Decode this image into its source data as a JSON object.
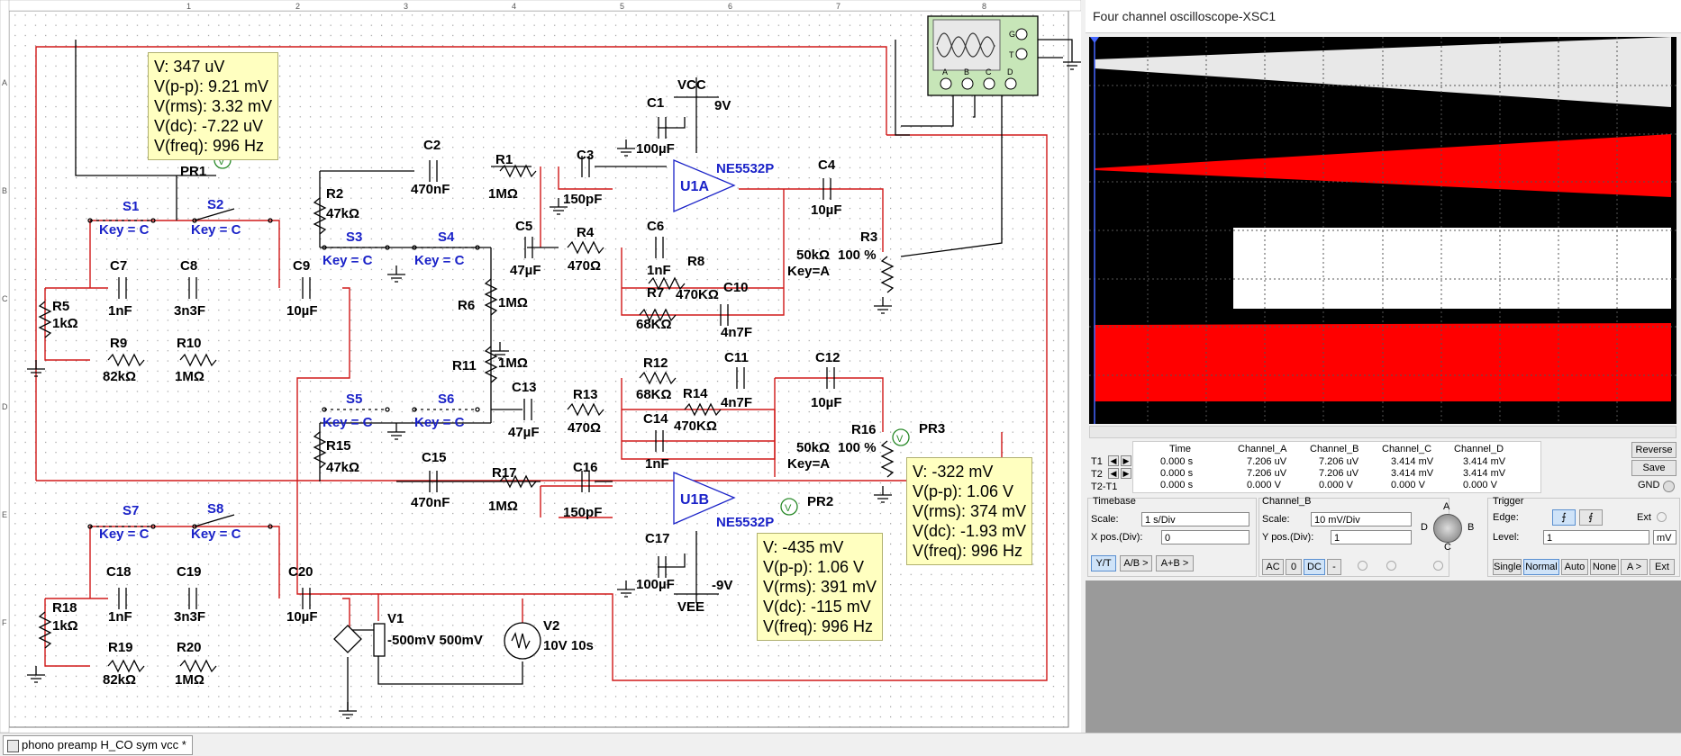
{
  "taskbar": {
    "tab_label": "phono preamp H_CO sym vcc *"
  },
  "ruler": {
    "cols": [
      "1",
      "2",
      "3",
      "4",
      "5",
      "6",
      "7",
      "8"
    ],
    "rows": [
      "A",
      "B",
      "C",
      "D",
      "E",
      "F"
    ]
  },
  "schematic": {
    "labels": {
      "pr1": "PR1",
      "pr2": "PR2",
      "pr3": "PR3",
      "vcc": "VCC",
      "vcc_val": "9V",
      "vee": "VEE",
      "vee_val": "-9V",
      "c1": "C1",
      "c1_val": "100µF",
      "c2": "C2",
      "c2_val": "470nF",
      "r1": "R1",
      "r1_val": "1MΩ",
      "c3": "C3",
      "c3_val": "150pF",
      "u1a": "U1A",
      "u1a_part": "NE5532P",
      "c4": "C4",
      "c4_val": "10µF",
      "r2": "R2",
      "r2_val": "47kΩ",
      "s1": "S1",
      "s1_key": "Key = C",
      "s2": "S2",
      "s2_key": "Key = C",
      "s3": "S3",
      "s3_key": "Key = C",
      "s4": "S4",
      "s4_key": "Key = C",
      "c5": "C5",
      "c5_val": "47µF",
      "r4": "R4",
      "r4_val": "470Ω",
      "c6": "C6",
      "c6_val": "1nF",
      "r8": "R8",
      "r8_val": "470KΩ",
      "r7": "R7",
      "r7_val": "68KΩ",
      "c10": "C10",
      "c10_val": "4n7F",
      "r3": "R3",
      "r3_val": "50kΩ",
      "r3_pct": "100 %",
      "r3_key": "Key=A",
      "c7": "C7",
      "c7_val": "1nF",
      "c8": "C8",
      "c8_val": "3n3F",
      "c9": "C9",
      "c9_val": "10µF",
      "r5": "R5",
      "r5_val": "1kΩ",
      "r9": "R9",
      "r9_val": "82kΩ",
      "r10": "R10",
      "r10_val": "1MΩ",
      "r6": "R6",
      "r6_val": "1MΩ",
      "r11": "R11",
      "r11_val": "1MΩ",
      "c13": "C13",
      "c13_val": "47µF",
      "r13": "R13",
      "r13_val": "470Ω",
      "r12": "R12",
      "r12_val": "68KΩ",
      "c11": "C11",
      "r14": "R14",
      "r14_val": "4n7F",
      "c12": "C12",
      "c12_val": "10µF",
      "c14": "C14",
      "c14_res": "470KΩ",
      "c14_val": "1nF",
      "s5": "S5",
      "s5_key": "Key = C",
      "s6": "S6",
      "s6_key": "Key = C",
      "r15": "R15",
      "r15_val": "47kΩ",
      "c15": "C15",
      "c15_val": "470nF",
      "r17": "R17",
      "r17_val": "1MΩ",
      "c16": "C16",
      "c16_val": "150pF",
      "u1b": "U1B",
      "u1b_part": "NE5532P",
      "c17": "C17",
      "c17_val": "100µF",
      "r16": "R16",
      "r16_val": "50kΩ",
      "r16_pct": "100 %",
      "r16_key": "Key=A",
      "s7": "S7",
      "s7_key": "Key = C",
      "s8": "S8",
      "s8_key": "Key = C",
      "c18": "C18",
      "c18_val": "1nF",
      "c19": "C19",
      "c19_val": "3n3F",
      "c20": "C20",
      "c20_val": "10µF",
      "r18": "R18",
      "r18_val": "1kΩ",
      "r19": "R19",
      "r19_val": "82kΩ",
      "r20": "R20",
      "r20_val": "1MΩ",
      "v1": "V1",
      "v1_val": "-500mV 500mV",
      "v2": "V2",
      "v2_val": "10V 10s",
      "scope_a": "A",
      "scope_b": "B",
      "scope_c": "C",
      "scope_d": "D",
      "scope_g": "G",
      "scope_t": "T"
    },
    "probe1": [
      "V: 347 uV",
      "V(p-p): 9.21 mV",
      "V(rms): 3.32 mV",
      "V(dc): -7.22 uV",
      "V(freq): 996 Hz"
    ],
    "probe2": [
      "V: -435 mV",
      "V(p-p): 1.06 V",
      "V(rms): 391 mV",
      "V(dc): -115 mV",
      "V(freq): 996 Hz"
    ],
    "probe3": [
      "V: -322 mV",
      "V(p-p): 1.06 V",
      "V(rms): 374 mV",
      "V(dc): -1.93 mV",
      "V(freq): 996 Hz"
    ],
    "colors": {
      "wire_red": "#d01818",
      "wire_black": "#000000",
      "probe_bg": "#ffffc0"
    }
  },
  "scope": {
    "title": "Four channel oscilloscope-XSC1",
    "channel_colors": {
      "a": "#e8e8e8",
      "b": "#ff0000",
      "c": "#ffffff",
      "d": "#ff0000"
    },
    "table": {
      "headers": [
        "Time",
        "Channel_A",
        "Channel_B",
        "Channel_C",
        "Channel_D"
      ],
      "rows": [
        {
          "label": "T1",
          "vals": [
            "0.000 s",
            "7.206 uV",
            "7.206 uV",
            "3.414 mV",
            "3.414 mV"
          ]
        },
        {
          "label": "T2",
          "vals": [
            "0.000 s",
            "7.206 uV",
            "7.206 uV",
            "3.414 mV",
            "3.414 mV"
          ]
        },
        {
          "label": "T2-T1",
          "vals": [
            "0.000 s",
            "0.000 V",
            "0.000 V",
            "0.000 V",
            "0.000 V"
          ]
        }
      ]
    },
    "buttons": {
      "reverse": "Reverse",
      "save": "Save",
      "gnd": "GND"
    },
    "timebase": {
      "title": "Timebase",
      "scale_label": "Scale:",
      "scale": "1 s/Div",
      "xpos_label": "X pos.(Div):",
      "xpos": "0",
      "yt": "Y/T",
      "ab": "A/B >",
      "apb": "A+B >"
    },
    "channel": {
      "title": "Channel_B",
      "scale_label": "Scale:",
      "scale": "10 mV/Div",
      "ypos_label": "Y pos.(Div):",
      "ypos": "1",
      "ac": "AC",
      "zero": "0",
      "dc": "DC",
      "minus": "-",
      "knob_a": "A",
      "knob_b": "B",
      "knob_c": "C",
      "knob_d": "D"
    },
    "trigger": {
      "title": "Trigger",
      "edge_label": "Edge:",
      "ext": "Ext",
      "level_label": "Level:",
      "level": "1",
      "level_unit": "mV",
      "single": "Single",
      "normal": "Normal",
      "auto": "Auto",
      "none": "None",
      "a": "A >",
      "ext_btn": "Ext"
    }
  }
}
